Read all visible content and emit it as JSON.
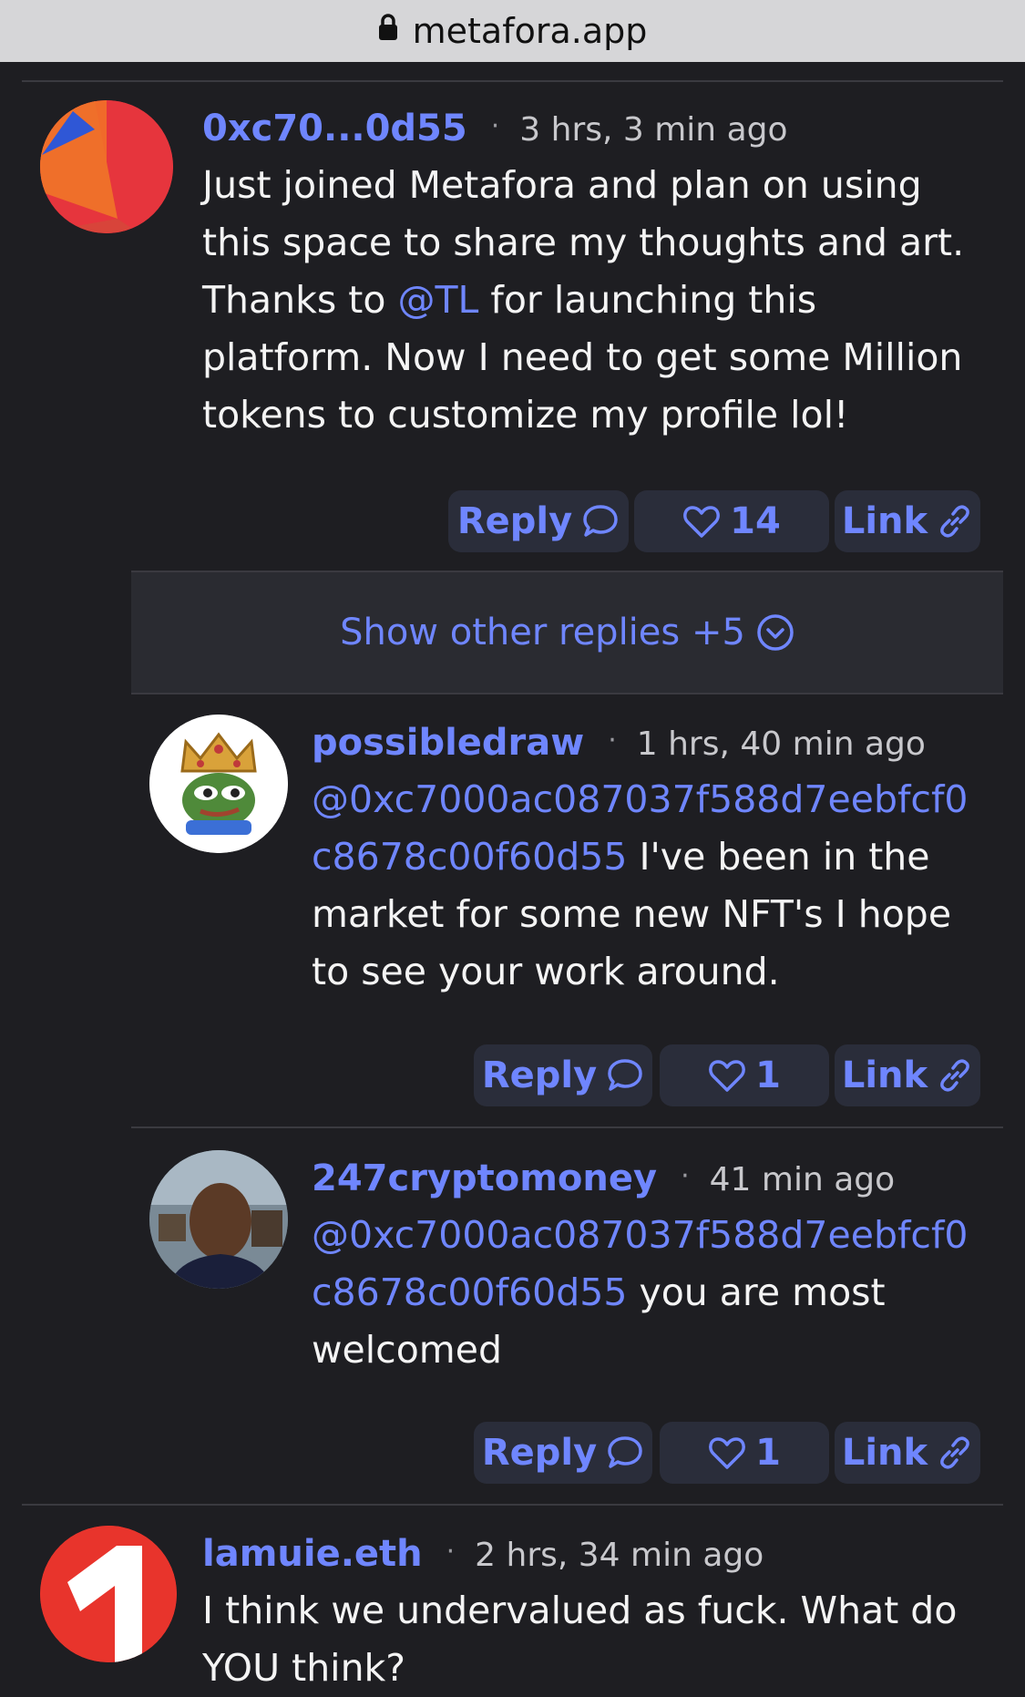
{
  "browser": {
    "url": "metafora.app"
  },
  "colors": {
    "accent": "#6f86ff",
    "background": "#1e1e22",
    "button_bg": "#2a2d3a"
  },
  "posts": [
    {
      "user": "0xc70...0d55",
      "time": "3 hrs, 3 min ago",
      "body_lines": [
        "Just joined Metafora and plan on using",
        "this space to share my thoughts and art.",
        [
          "Thanks to ",
          "@TL",
          " for launching this"
        ],
        "platform. Now I need to get some Million",
        "tokens to customize my profile lol!"
      ],
      "reply_label": "Reply",
      "likes": "14",
      "link_label": "Link",
      "avatar_icon": "orange-red-pie-avatar"
    },
    {
      "user": "possibledraw",
      "time": "1 hrs, 40 min ago",
      "body_lines": [
        "@0xc7000ac087037f588d7eebfcf0",
        [
          "c8678c00f60d55",
          " I've been in the"
        ],
        "market for some new NFT's I hope",
        "to see your work around."
      ],
      "reply_label": "Reply",
      "likes": "1",
      "link_label": "Link",
      "avatar_icon": "pepe-king-avatar"
    },
    {
      "user": "247cryptomoney",
      "time": "41 min ago",
      "body_lines": [
        "@0xc7000ac087037f588d7eebfcf0",
        [
          "c8678c00f60d55",
          " you are most"
        ],
        "welcomed"
      ],
      "reply_label": "Reply",
      "likes": "1",
      "link_label": "Link",
      "avatar_icon": "person-photo-avatar"
    },
    {
      "user": "lamuie.eth",
      "time": "2 hrs, 34 min ago",
      "body_lines": [
        "I think we undervalued as fuck. What do",
        "YOU think?"
      ],
      "avatar_icon": "number-one-avatar"
    }
  ],
  "show_more": {
    "label": "Show other replies +5"
  }
}
